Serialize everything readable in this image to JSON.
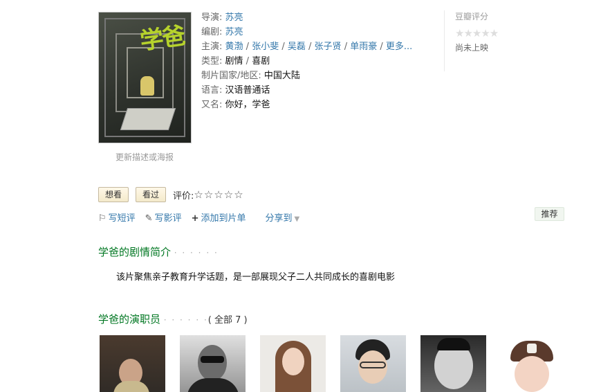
{
  "poster": {
    "title_art": "学爸"
  },
  "update_link": "更新描述或海报",
  "info": {
    "director_label": "导演:",
    "director": "苏亮",
    "writer_label": "编剧:",
    "writer": "苏亮",
    "cast_label": "主演:",
    "cast": [
      "黄渤",
      "张小斐",
      "吴磊",
      "张子贤",
      "单雨豪"
    ],
    "cast_more": "更多...",
    "genre_label": "类型:",
    "genre": [
      "剧情",
      "喜剧"
    ],
    "region_label": "制片国家/地区:",
    "region": "中国大陆",
    "language_label": "语言:",
    "language": "汉语普通话",
    "aka_label": "又名:",
    "aka": "你好，学爸"
  },
  "rating": {
    "title": "豆瓣评分",
    "stars": "★★★★★",
    "status": "尚未上映"
  },
  "actions": {
    "want": "想看",
    "seen": "看过",
    "rate_label": "评价:",
    "rate_stars": "☆☆☆☆☆"
  },
  "links": {
    "short_review": "写短评",
    "review": "写影评",
    "add_list": "添加到片单",
    "share": "分享到",
    "recommend": "推荐"
  },
  "synopsis": {
    "heading": "学爸的剧情简介",
    "dots": "· · · · · ·",
    "text": "该片聚焦亲子教育升学话题，是一部展现父子二人共同成长的喜剧电影"
  },
  "cast_section": {
    "heading": "学爸的演职员",
    "dots": "· · · · · ·",
    "all": "( 全部 7 )"
  }
}
